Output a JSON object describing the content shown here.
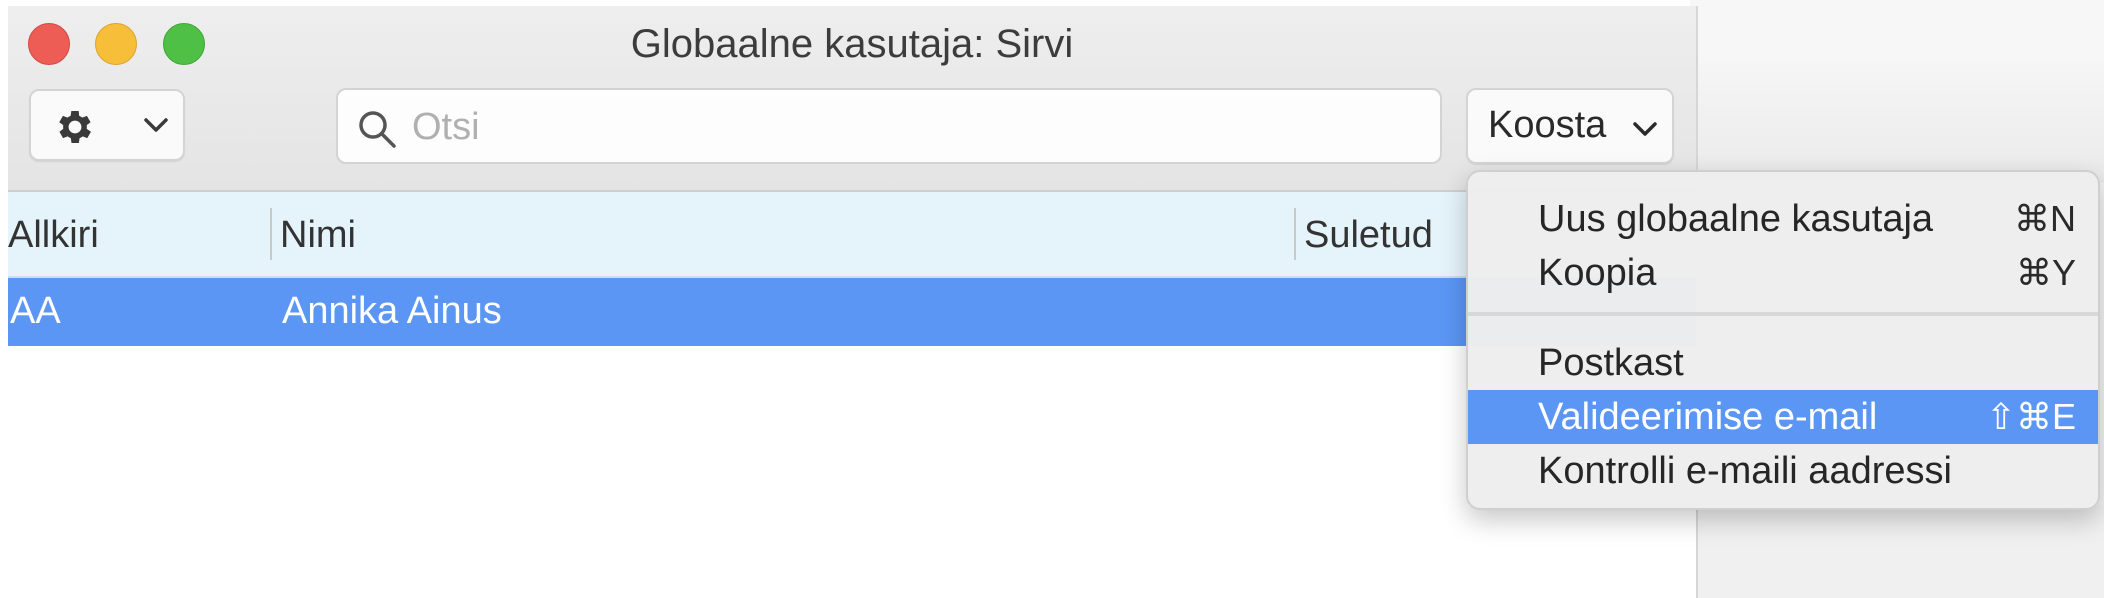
{
  "window": {
    "title": "Globaalne kasutaja: Sirvi"
  },
  "toolbar": {
    "settings_icon": "gear-icon",
    "search_placeholder": "Otsi",
    "search_value": "",
    "compose_label": "Koosta"
  },
  "table": {
    "columns": [
      "Allkiri",
      "Nimi",
      "Suletud"
    ],
    "rows": [
      {
        "signature": "AA",
        "name": "Annika Ainus",
        "closed": "",
        "selected": true
      }
    ]
  },
  "compose_menu": {
    "items": [
      {
        "label": "Uus globaalne kasutaja",
        "shortcut": "⌘N"
      },
      {
        "label": "Koopia",
        "shortcut": "⌘Y"
      },
      {
        "label": "Postkast",
        "shortcut": ""
      },
      {
        "label": "Valideerimise e-mail",
        "shortcut": "⇧⌘E",
        "highlighted": true
      },
      {
        "label": "Kontrolli e-maili aadressi",
        "shortcut": ""
      }
    ]
  },
  "colors": {
    "selection": "#5b96f4",
    "header_bg": "#e5f4fb",
    "close": "#ee5d55",
    "minimize": "#f7be3a",
    "maximize": "#4fc046"
  }
}
